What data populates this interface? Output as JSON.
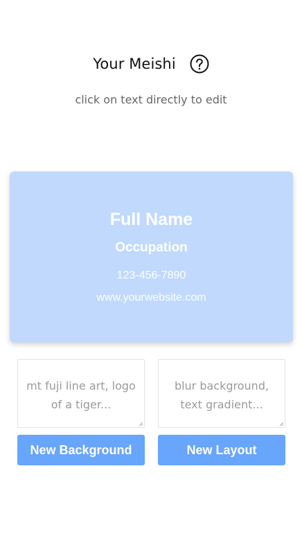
{
  "header": {
    "title": "Your Meishi",
    "help_icon": "question-circle-icon"
  },
  "instructions": "click on text directly to edit",
  "card": {
    "background_color": "#c0d9fc",
    "text_color": "#ffffff",
    "full_name": "Full Name",
    "occupation": "Occupation",
    "phone": "123-456-7890",
    "website": "www.yourwebsite.com"
  },
  "prompts": {
    "background_placeholder": "mt fuji line art, logo of a tiger...",
    "layout_placeholder": "blur background, text gradient..."
  },
  "buttons": {
    "new_background": "New Background",
    "new_layout": "New Layout",
    "color": "#68a5fc"
  }
}
